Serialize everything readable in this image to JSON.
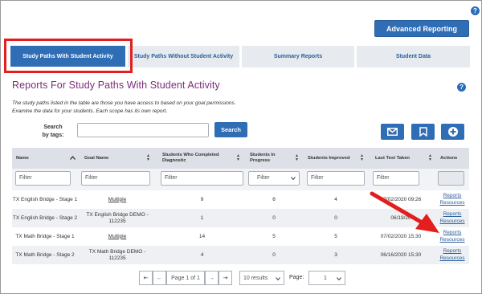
{
  "header": {
    "help_glyph": "?",
    "advanced_reporting_label": "Advanced Reporting"
  },
  "tabs": [
    {
      "label": "Study Paths With Student Activity",
      "active": true
    },
    {
      "label": "Study Paths Without Student Activity",
      "active": false
    },
    {
      "label": "Summary Reports",
      "active": false
    },
    {
      "label": "Student Data",
      "active": false
    }
  ],
  "section": {
    "title": "Reports For Study Paths With Student Activity",
    "help_glyph": "?",
    "description_line1": "The study paths listed in the table are those you have access to based on your goal permissions.",
    "description_line2": "Examine the data for your students. Each scope has its own report."
  },
  "search": {
    "label_line1": "Search",
    "label_line2": "by tags:",
    "input_value": "",
    "button_label": "Search"
  },
  "toolbar_icons": [
    "envelope-icon",
    "bookmark-icon",
    "plus-icon"
  ],
  "table": {
    "columns": [
      "Name",
      "Goal Name",
      "Students Who Completed Diagnostic",
      "Students In Progress",
      "Students Improved",
      "Last Test Taken",
      "Actions"
    ],
    "filters": {
      "name": "Filter",
      "goal": "Filter",
      "completed": "Filter",
      "progress": "Filter",
      "improved": "Filter",
      "last_test": "Filter"
    },
    "rows": [
      {
        "name": "TX English Bridge - Stage 1",
        "goal": "Multiple",
        "goal_link": true,
        "completed": "9",
        "progress": "6",
        "improved": "4",
        "last_test": "07/02/2020 09:26",
        "a1": "Reports",
        "a2": "Resources"
      },
      {
        "name": "TX English Bridge - Stage 2",
        "goal": "TX English Bridge DEMO - 112235",
        "goal_link": false,
        "completed": "1",
        "progress": "0",
        "improved": "0",
        "last_test": "06/19/20",
        "a1": "Reports",
        "a2": "Resources"
      },
      {
        "name": "TX Math Bridge - Stage 1",
        "goal": "Multiple",
        "goal_link": true,
        "completed": "14",
        "progress": "5",
        "improved": "5",
        "last_test": "07/02/2020 15:30",
        "a1": "Reports",
        "a2": "Resources"
      },
      {
        "name": "TX Math Bridge - Stage 2",
        "goal": "TX Math Bridge DEMO - 112235",
        "goal_link": false,
        "completed": "4",
        "progress": "0",
        "improved": "3",
        "last_test": "06/16/2020 15:30",
        "a1": "Reports",
        "a2": "Resources"
      }
    ]
  },
  "pagination": {
    "first": "⇤",
    "prev": "←",
    "page_text": "Page 1 of 1",
    "next": "→",
    "last": "⇥",
    "results_select": "10 results",
    "page_label": "Page:",
    "page_select": "1"
  },
  "colors": {
    "primary": "#2f6db5",
    "title_purple": "#7a2d7a",
    "highlight_red": "#e41d1d"
  }
}
